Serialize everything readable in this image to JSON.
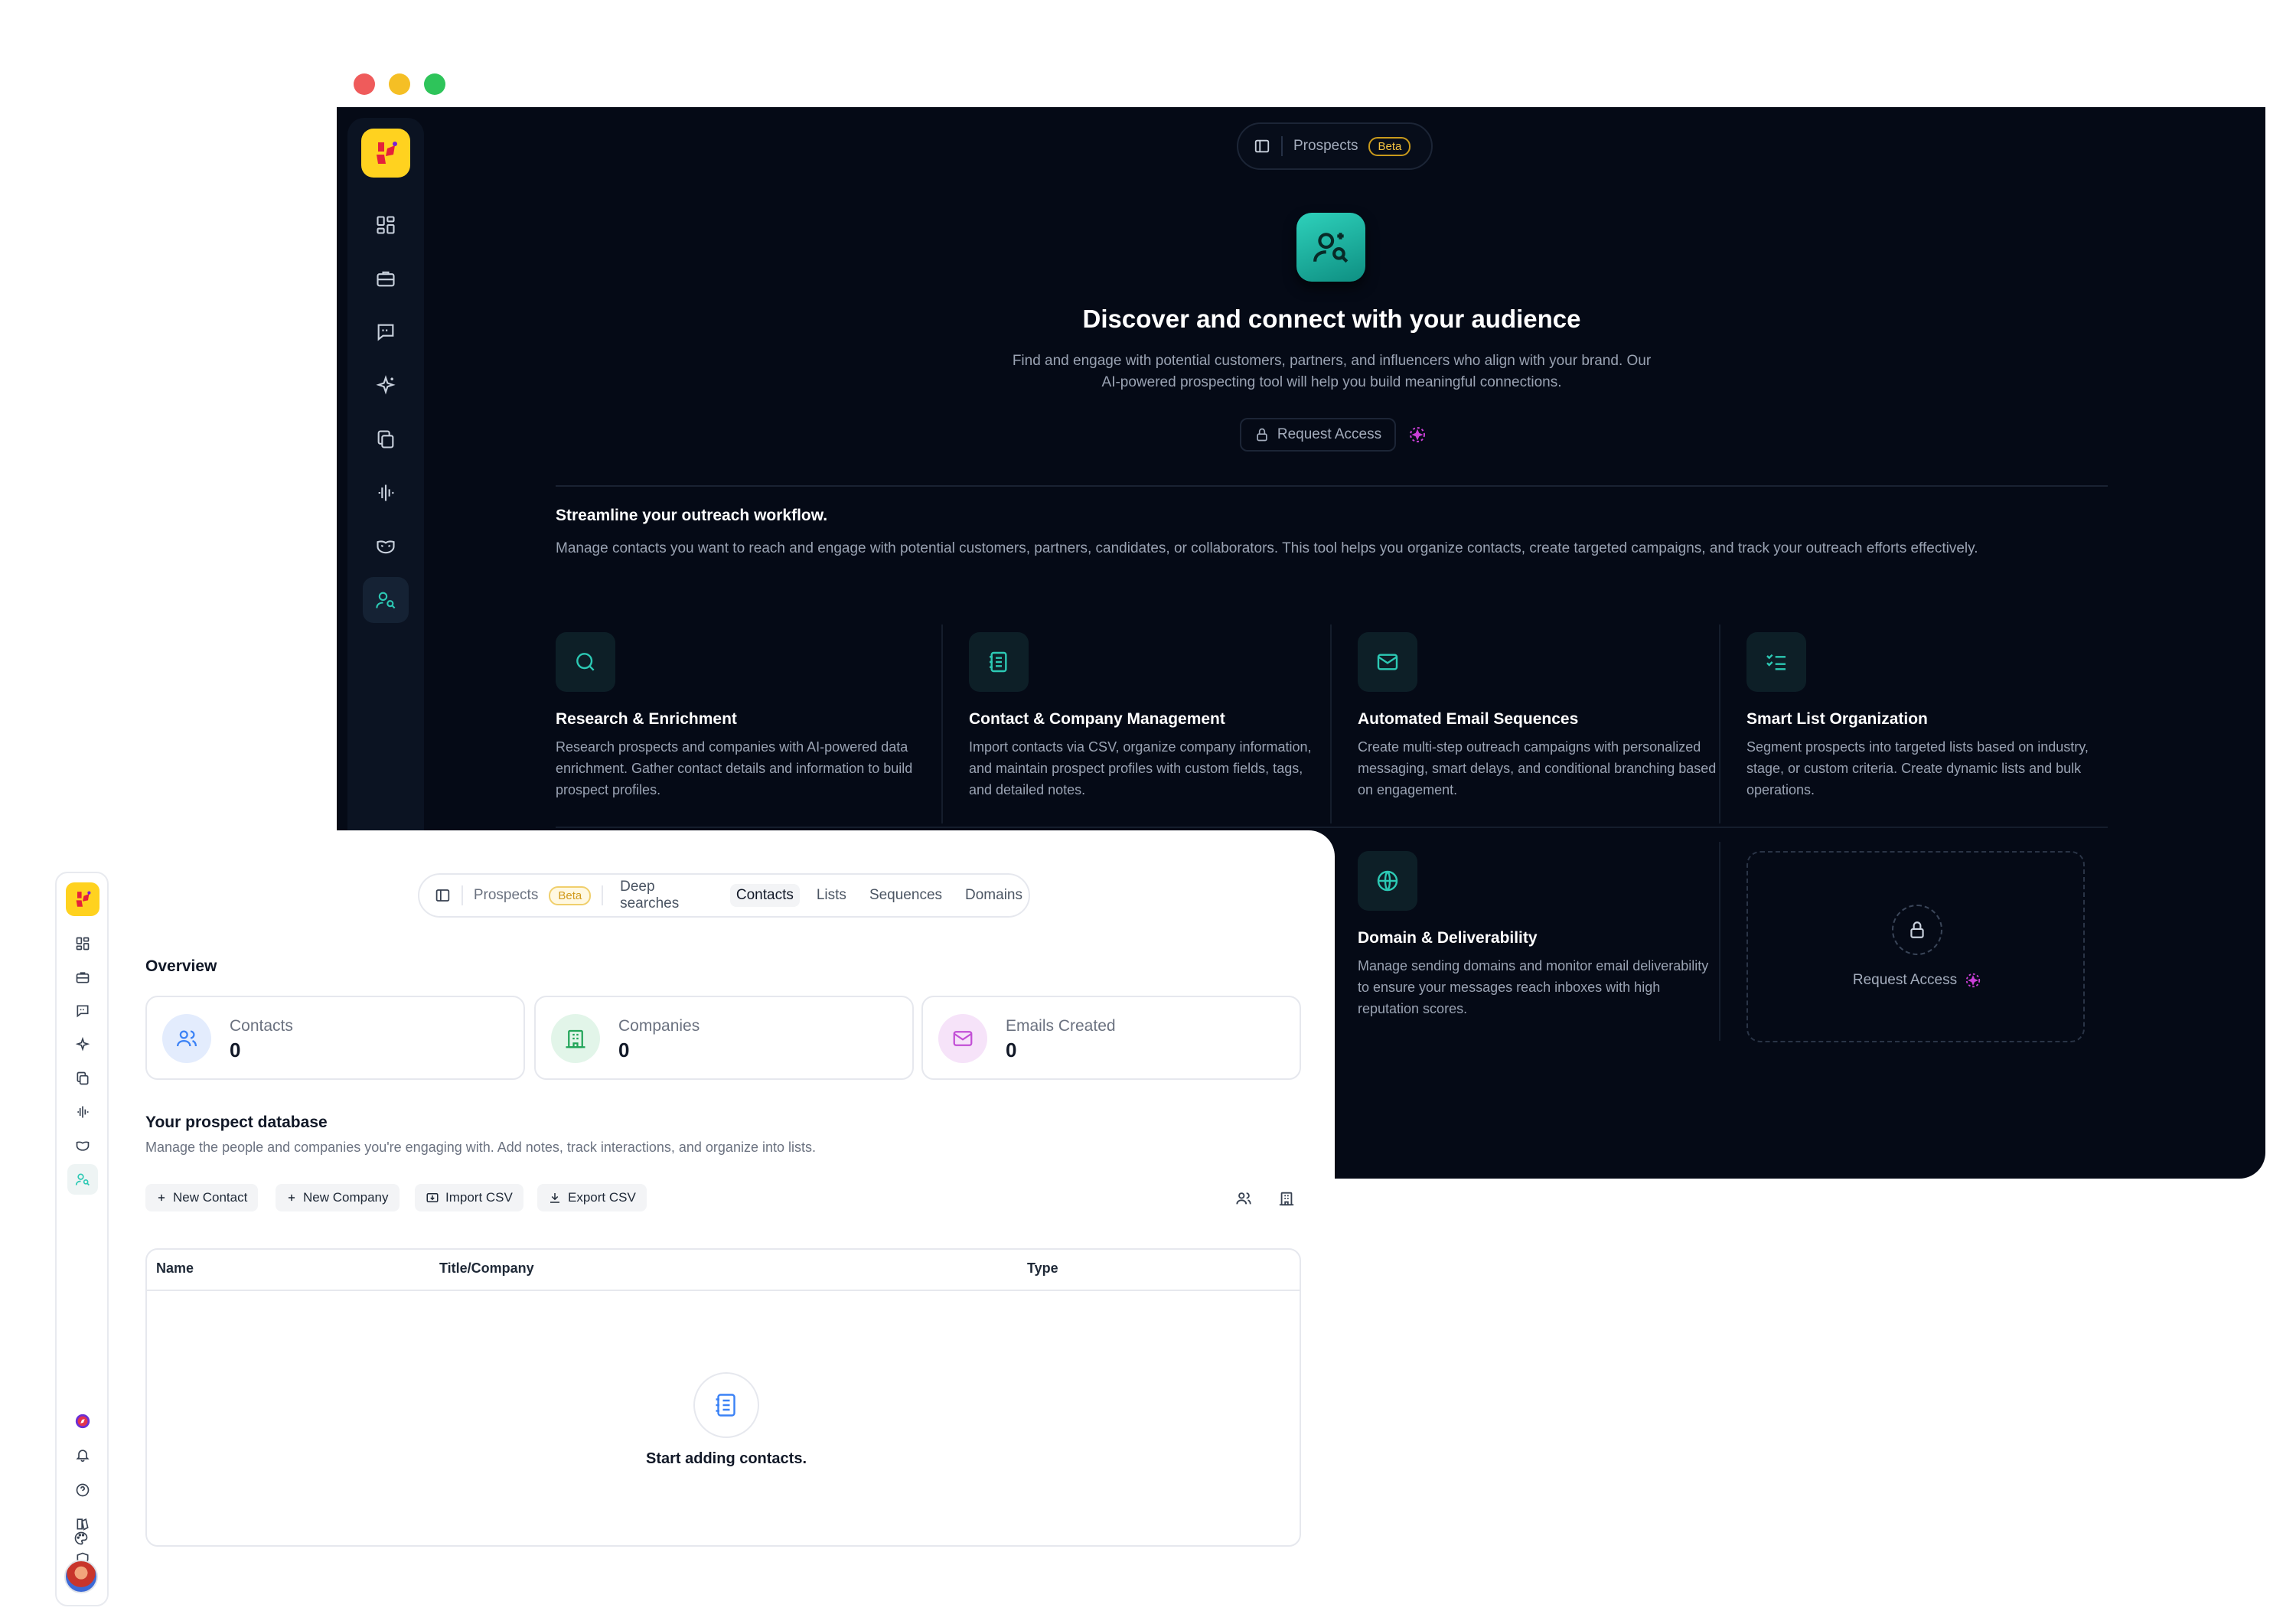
{
  "dark": {
    "window_dots": [
      "#ef5b5b",
      "#f5bf25",
      "#2ec45a"
    ],
    "nav": {
      "page_label": "Prospects",
      "beta": "Beta"
    },
    "hero": {
      "title": "Discover and connect with your audience",
      "desc_line1": "Find and engage with potential customers, partners, and influencers who align with your brand. Our",
      "desc_line2": "AI-powered prospecting tool will help you build meaningful connections.",
      "request_access": "Request Access"
    },
    "section": {
      "title": "Streamline your outreach workflow.",
      "desc": "Manage contacts you want to reach and engage with potential customers, partners, candidates, or collaborators. This tool helps you organize contacts, create targeted campaigns, and track your outreach efforts effectively."
    },
    "features": [
      {
        "icon": "search-icon",
        "title": "Research & Enrichment",
        "desc": "Research prospects and companies with AI-powered data enrichment. Gather contact details and information to build prospect profiles."
      },
      {
        "icon": "notebook-icon",
        "title": "Contact & Company Management",
        "desc": "Import contacts via CSV, organize company information, and maintain prospect profiles with custom fields, tags, and detailed notes."
      },
      {
        "icon": "mail-icon",
        "title": "Automated Email Sequences",
        "desc": "Create multi-step outreach campaigns with personalized messaging, smart delays, and conditional branching based on engagement."
      },
      {
        "icon": "checklist-icon",
        "title": "Smart List Organization",
        "desc": "Segment prospects into targeted lists based on industry, stage, or custom criteria. Create dynamic lists and bulk operations."
      },
      {
        "icon": "globe-icon",
        "title": "Domain & Deliverability",
        "desc": "Manage sending domains and monitor email deliverability to ensure your messages reach inboxes with high reputation scores."
      }
    ],
    "lock_card": {
      "label": "Request Access"
    }
  },
  "light": {
    "window_dots": [
      "#ef5b5b",
      "#f5bf25",
      "#2ec45a"
    ],
    "nav": {
      "page_label": "Prospects",
      "beta": "Beta",
      "tabs": [
        "Deep searches",
        "Contacts",
        "Lists",
        "Sequences",
        "Domains"
      ],
      "active_tab": "Contacts"
    },
    "overview": {
      "title": "Overview",
      "stats": [
        {
          "label": "Contacts",
          "value": "0",
          "icon": "users-icon",
          "color": "#3b82f6"
        },
        {
          "label": "Companies",
          "value": "0",
          "icon": "building-icon",
          "color": "#22a559"
        },
        {
          "label": "Emails Created",
          "value": "0",
          "icon": "mail-icon",
          "color": "#c24fd6"
        }
      ]
    },
    "database": {
      "title": "Your prospect database",
      "desc": "Manage the people and companies you're engaging with. Add notes, track interactions, and organize into lists.",
      "buttons": [
        "New Contact",
        "New Company",
        "Import CSV",
        "Export CSV"
      ]
    },
    "table": {
      "columns": [
        "Name",
        "Title/Company",
        "Type"
      ],
      "empty": "Start adding contacts."
    }
  },
  "colors": {
    "accent_teal": "#2cc9b4",
    "dark_bg": "#050a16",
    "beta_yellow": "#f5c441"
  }
}
